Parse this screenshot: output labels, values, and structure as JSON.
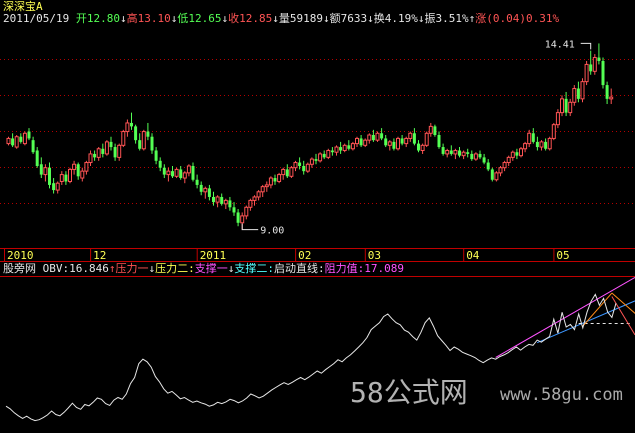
{
  "header": {
    "title": "深深宝A",
    "date": "2011/05/19",
    "open": {
      "label": "开",
      "value": "12.80"
    },
    "high": {
      "label": "高",
      "value": "13.10"
    },
    "low": {
      "label": "低",
      "value": "12.65"
    },
    "close": {
      "label": "收",
      "value": "12.85"
    },
    "volume": {
      "label": "量",
      "value": "59189"
    },
    "amount": {
      "label": "额",
      "value": "7633"
    },
    "turnover": {
      "label": "换",
      "value": "4.19%"
    },
    "amplitude": {
      "label": "振",
      "value": "3.51%"
    },
    "change": {
      "label": "涨",
      "value": "(0.04)",
      "pct": "0.31%"
    }
  },
  "indicator": {
    "site": "股旁网",
    "obv_label": "OBV:",
    "obv_value": "16.846",
    "pressure1": "压力一",
    "pressure2": "压力二:",
    "support1": "支撑一",
    "support2": "支撑二:",
    "start_line": "启动直线:",
    "resistance_label": "阻力值:",
    "resistance_value": "17.089"
  },
  "watermark": {
    "brand": "58公式网",
    "url": "www.58gu.com"
  },
  "colors": {
    "up": "#ff5454",
    "down": "#54ff54",
    "flat": "#e6e6e6",
    "grid": "#b40000",
    "axis": "#c00000",
    "white": "#e6e6e6",
    "yellow": "#ffff54",
    "magenta": "#ff54ff",
    "cyan": "#54ffff",
    "orange": "#ff8c1a",
    "blue": "#3c96ff"
  },
  "chart_data": [
    {
      "type": "candlestick",
      "ylim": [
        8.7,
        14.8
      ],
      "x_labels": [
        {
          "index": 0,
          "label": "2010"
        },
        {
          "index": 21,
          "label": "12"
        },
        {
          "index": 47,
          "label": "2011"
        },
        {
          "index": 71,
          "label": "02"
        },
        {
          "index": 88,
          "label": "03"
        },
        {
          "index": 112,
          "label": "04"
        },
        {
          "index": 134,
          "label": "05"
        }
      ],
      "annotations": [
        {
          "label": "14.41",
          "index": 142,
          "value": 14.41
        },
        {
          "label": "9.00",
          "index": 57,
          "value": 9.0
        }
      ],
      "candles": [
        [
          11.5,
          11.7,
          11.45,
          11.65
        ],
        [
          11.65,
          11.8,
          11.4,
          11.45
        ],
        [
          11.4,
          11.75,
          11.35,
          11.7
        ],
        [
          11.7,
          11.8,
          11.5,
          11.55
        ],
        [
          11.5,
          11.85,
          11.45,
          11.8
        ],
        [
          11.85,
          11.95,
          11.6,
          11.65
        ],
        [
          11.6,
          11.7,
          11.2,
          11.25
        ],
        [
          11.3,
          11.4,
          10.8,
          10.85
        ],
        [
          10.9,
          11.1,
          10.5,
          10.6
        ],
        [
          10.6,
          10.9,
          10.4,
          10.8
        ],
        [
          10.8,
          10.95,
          10.2,
          10.3
        ],
        [
          10.35,
          10.5,
          10.05,
          10.15
        ],
        [
          10.15,
          10.4,
          10.05,
          10.35
        ],
        [
          10.4,
          10.7,
          10.3,
          10.6
        ],
        [
          10.6,
          10.7,
          10.3,
          10.4
        ],
        [
          10.4,
          10.8,
          10.35,
          10.75
        ],
        [
          10.75,
          11.0,
          10.6,
          10.9
        ],
        [
          10.9,
          10.95,
          10.45,
          10.55
        ],
        [
          10.5,
          10.8,
          10.4,
          10.7
        ],
        [
          10.7,
          11.0,
          10.6,
          10.95
        ],
        [
          10.95,
          11.3,
          10.85,
          11.2
        ],
        [
          11.2,
          11.3,
          11.0,
          11.1
        ],
        [
          11.1,
          11.4,
          11.0,
          11.35
        ],
        [
          11.35,
          11.5,
          11.1,
          11.2
        ],
        [
          11.2,
          11.6,
          11.15,
          11.55
        ],
        [
          11.55,
          11.7,
          11.3,
          11.4
        ],
        [
          11.4,
          11.5,
          11.0,
          11.1
        ],
        [
          11.1,
          11.5,
          11.0,
          11.45
        ],
        [
          11.45,
          11.9,
          11.4,
          11.85
        ],
        [
          11.85,
          12.2,
          11.7,
          12.1
        ],
        [
          12.1,
          12.4,
          11.9,
          12.0
        ],
        [
          12.0,
          12.05,
          11.5,
          11.6
        ],
        [
          11.6,
          11.8,
          11.3,
          11.35
        ],
        [
          11.35,
          11.9,
          11.3,
          11.85
        ],
        [
          11.85,
          12.1,
          11.6,
          11.7
        ],
        [
          11.7,
          11.8,
          11.2,
          11.3
        ],
        [
          11.3,
          11.4,
          10.9,
          11.0
        ],
        [
          11.0,
          11.1,
          10.7,
          10.8
        ],
        [
          10.8,
          10.9,
          10.5,
          10.6
        ],
        [
          10.6,
          10.8,
          10.4,
          10.7
        ],
        [
          10.7,
          10.85,
          10.5,
          10.55
        ],
        [
          10.55,
          10.8,
          10.5,
          10.75
        ],
        [
          10.75,
          10.85,
          10.45,
          10.5
        ],
        [
          10.5,
          10.7,
          10.35,
          10.65
        ],
        [
          10.65,
          10.9,
          10.55,
          10.85
        ],
        [
          10.85,
          10.95,
          10.4,
          10.45
        ],
        [
          10.45,
          10.6,
          10.2,
          10.3
        ],
        [
          10.3,
          10.4,
          10.0,
          10.1
        ],
        [
          10.1,
          10.25,
          9.9,
          10.2
        ],
        [
          10.2,
          10.3,
          9.85,
          9.95
        ],
        [
          9.95,
          10.1,
          9.7,
          9.8
        ],
        [
          9.8,
          10.0,
          9.65,
          9.95
        ],
        [
          9.95,
          10.05,
          9.7,
          9.75
        ],
        [
          9.75,
          9.9,
          9.6,
          9.85
        ],
        [
          9.85,
          9.95,
          9.55,
          9.65
        ],
        [
          9.65,
          9.8,
          9.4,
          9.5
        ],
        [
          9.5,
          9.6,
          9.1,
          9.2
        ],
        [
          9.2,
          9.5,
          9.0,
          9.4
        ],
        [
          9.4,
          9.7,
          9.3,
          9.65
        ],
        [
          9.65,
          9.9,
          9.55,
          9.85
        ],
        [
          9.85,
          10.0,
          9.7,
          9.95
        ],
        [
          9.95,
          10.15,
          9.85,
          10.1
        ],
        [
          10.1,
          10.3,
          9.95,
          10.25
        ],
        [
          10.25,
          10.4,
          10.1,
          10.3
        ],
        [
          10.3,
          10.55,
          10.2,
          10.5
        ],
        [
          10.5,
          10.6,
          10.3,
          10.4
        ],
        [
          10.4,
          10.65,
          10.35,
          10.6
        ],
        [
          10.6,
          10.8,
          10.45,
          10.75
        ],
        [
          10.75,
          10.9,
          10.5,
          10.55
        ],
        [
          10.55,
          10.85,
          10.5,
          10.8
        ],
        [
          10.8,
          11.0,
          10.7,
          10.95
        ],
        [
          10.95,
          11.1,
          10.75,
          10.85
        ],
        [
          10.85,
          11.0,
          10.6,
          10.7
        ],
        [
          10.7,
          10.95,
          10.65,
          10.9
        ],
        [
          10.9,
          11.1,
          10.8,
          11.05
        ],
        [
          11.05,
          11.2,
          10.9,
          11.0
        ],
        [
          11.0,
          11.25,
          10.95,
          11.2
        ],
        [
          11.2,
          11.3,
          11.05,
          11.1
        ],
        [
          11.1,
          11.35,
          11.05,
          11.3
        ],
        [
          11.3,
          11.4,
          11.15,
          11.25
        ],
        [
          11.25,
          11.45,
          11.15,
          11.4
        ],
        [
          11.4,
          11.55,
          11.2,
          11.3
        ],
        [
          11.3,
          11.5,
          11.25,
          11.45
        ],
        [
          11.45,
          11.6,
          11.3,
          11.35
        ],
        [
          11.35,
          11.55,
          11.3,
          11.5
        ],
        [
          11.5,
          11.7,
          11.4,
          11.65
        ],
        [
          11.65,
          11.75,
          11.4,
          11.45
        ],
        [
          11.45,
          11.65,
          11.4,
          11.6
        ],
        [
          11.6,
          11.8,
          11.5,
          11.75
        ],
        [
          11.75,
          11.9,
          11.55,
          11.6
        ],
        [
          11.6,
          11.85,
          11.55,
          11.8
        ],
        [
          11.8,
          11.95,
          11.6,
          11.65
        ],
        [
          11.65,
          11.75,
          11.4,
          11.45
        ],
        [
          11.45,
          11.6,
          11.3,
          11.55
        ],
        [
          11.55,
          11.65,
          11.3,
          11.35
        ],
        [
          11.35,
          11.7,
          11.3,
          11.65
        ],
        [
          11.65,
          11.75,
          11.45,
          11.5
        ],
        [
          11.5,
          11.7,
          11.4,
          11.65
        ],
        [
          11.65,
          11.85,
          11.55,
          11.8
        ],
        [
          11.8,
          11.95,
          11.45,
          11.5
        ],
        [
          11.5,
          11.6,
          11.25,
          11.3
        ],
        [
          11.3,
          11.5,
          11.2,
          11.45
        ],
        [
          11.45,
          11.85,
          11.4,
          11.8
        ],
        [
          11.8,
          12.1,
          11.7,
          12.0
        ],
        [
          12.0,
          12.05,
          11.7,
          11.75
        ],
        [
          11.75,
          11.85,
          11.35,
          11.4
        ],
        [
          11.4,
          11.5,
          11.15,
          11.2
        ],
        [
          11.2,
          11.35,
          11.1,
          11.3
        ],
        [
          11.3,
          11.45,
          11.15,
          11.2
        ],
        [
          11.2,
          11.35,
          11.05,
          11.3
        ],
        [
          11.3,
          11.4,
          11.1,
          11.15
        ],
        [
          11.15,
          11.3,
          11.05,
          11.25
        ],
        [
          11.25,
          11.35,
          11.1,
          11.2
        ],
        [
          11.2,
          11.3,
          11.0,
          11.05
        ],
        [
          11.05,
          11.25,
          11.0,
          11.2
        ],
        [
          11.2,
          11.3,
          11.05,
          11.1
        ],
        [
          11.1,
          11.2,
          10.9,
          10.95
        ],
        [
          10.95,
          11.05,
          10.7,
          10.75
        ],
        [
          10.75,
          10.8,
          10.4,
          10.45
        ],
        [
          10.45,
          10.7,
          10.4,
          10.65
        ],
        [
          10.65,
          10.85,
          10.55,
          10.8
        ],
        [
          10.8,
          11.0,
          10.7,
          10.95
        ],
        [
          10.95,
          11.15,
          10.85,
          11.1
        ],
        [
          11.1,
          11.3,
          11.0,
          11.25
        ],
        [
          11.25,
          11.35,
          11.05,
          11.15
        ],
        [
          11.15,
          11.4,
          11.1,
          11.35
        ],
        [
          11.35,
          11.55,
          11.25,
          11.5
        ],
        [
          11.5,
          11.9,
          11.4,
          11.8
        ],
        [
          11.8,
          11.95,
          11.5,
          11.55
        ],
        [
          11.55,
          11.7,
          11.3,
          11.4
        ],
        [
          11.4,
          11.6,
          11.3,
          11.55
        ],
        [
          11.55,
          11.65,
          11.3,
          11.35
        ],
        [
          11.35,
          11.7,
          11.3,
          11.65
        ],
        [
          11.65,
          12.1,
          11.6,
          12.05
        ],
        [
          12.05,
          12.5,
          11.95,
          12.4
        ],
        [
          12.4,
          12.9,
          12.3,
          12.8
        ],
        [
          12.8,
          13.0,
          12.3,
          12.4
        ],
        [
          12.4,
          12.8,
          12.3,
          12.7
        ],
        [
          12.7,
          13.2,
          12.6,
          13.1
        ],
        [
          13.1,
          13.3,
          12.7,
          12.8
        ],
        [
          12.8,
          13.4,
          12.7,
          13.3
        ],
        [
          13.3,
          13.9,
          13.2,
          13.8
        ],
        [
          13.8,
          14.2,
          13.5,
          13.6
        ],
        [
          13.6,
          14.1,
          13.5,
          14.0
        ],
        [
          14.0,
          14.41,
          13.8,
          13.9
        ],
        [
          13.9,
          14.0,
          13.1,
          13.2
        ],
        [
          13.2,
          13.3,
          12.65,
          12.8
        ],
        [
          12.8,
          13.1,
          12.65,
          12.85
        ]
      ]
    },
    {
      "type": "line",
      "series": [
        {
          "name": "OBV",
          "values": [
            5.0,
            4.7,
            4.25,
            3.9,
            3.6,
            3.85,
            3.55,
            3.35,
            3.45,
            3.7,
            4.0,
            4.45,
            4.05,
            3.9,
            4.3,
            4.8,
            5.35,
            4.85,
            4.65,
            5.2,
            5.05,
            5.45,
            5.95,
            5.8,
            5.3,
            5.1,
            5.7,
            6.0,
            5.8,
            6.4,
            7.6,
            8.3,
            9.9,
            10.4,
            10.1,
            9.5,
            8.4,
            7.8,
            7.0,
            6.5,
            6.7,
            6.3,
            5.85,
            6.0,
            5.7,
            5.45,
            5.6,
            5.4,
            5.25,
            5.0,
            5.15,
            5.45,
            5.3,
            5.5,
            5.8,
            5.65,
            5.4,
            5.6,
            5.95,
            6.4,
            6.2,
            5.95,
            6.15,
            6.5,
            6.85,
            7.15,
            7.45,
            7.7,
            7.5,
            7.75,
            8.05,
            8.3,
            8.05,
            8.35,
            8.7,
            9.05,
            8.8,
            9.2,
            9.55,
            9.9,
            10.35,
            10.1,
            10.55,
            10.9,
            11.35,
            11.8,
            12.3,
            12.9,
            13.8,
            14.2,
            14.6,
            15.3,
            15.6,
            15.05,
            14.6,
            14.35,
            13.75,
            13.5,
            13.0,
            12.6,
            13.5,
            14.6,
            15.15,
            14.2,
            13.1,
            12.55,
            12.0,
            11.4,
            11.8,
            11.55,
            11.2,
            11.0,
            10.8,
            10.6,
            10.25,
            10.0,
            10.3,
            10.55,
            10.4,
            10.7,
            10.9,
            11.15,
            11.5,
            11.8,
            11.45,
            11.8,
            12.1,
            12.0,
            12.6,
            12.35,
            12.7,
            13.0,
            15.0,
            13.4,
            15.8,
            14.1,
            14.4,
            13.8,
            15.6,
            14.0,
            15.8,
            17.05,
            17.85,
            16.6,
            17.4,
            15.8,
            15.2,
            16.85
          ]
        }
      ],
      "annotations": [
        {
          "label": "OBV:16.846"
        }
      ]
    }
  ]
}
